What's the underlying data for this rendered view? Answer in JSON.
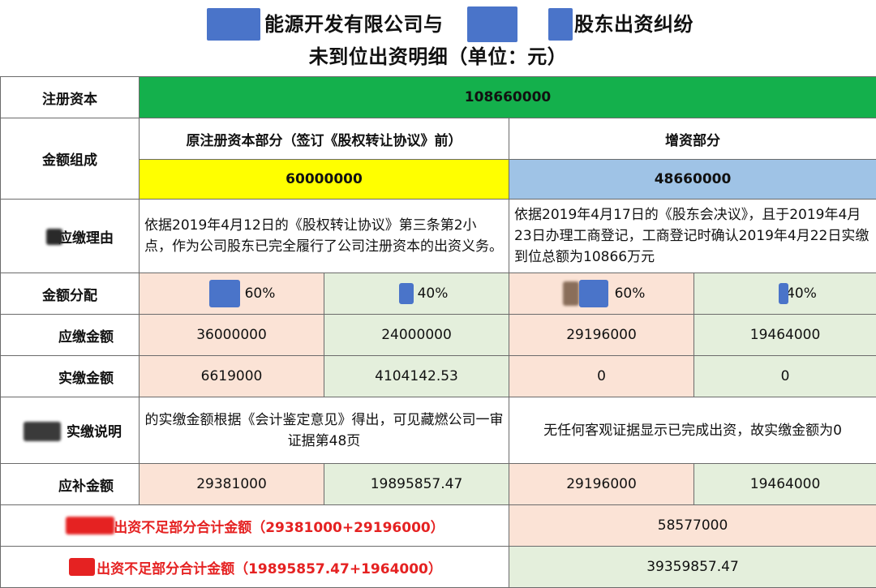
{
  "title": {
    "line1_part1": "能源开发有限公司与",
    "line1_part2": "股东出资纠纷",
    "line2": "未到位出资明细（单位：元）"
  },
  "rows": {
    "registered_capital": {
      "label": "注册资本",
      "value": "108660000"
    },
    "composition": {
      "label": "金额组成",
      "original_header": "原注册资本部分（签订《股权转让协议》前）",
      "increase_header": "增资部分",
      "original_value": "60000000",
      "increase_value": "48660000"
    },
    "payment_reason": {
      "label": "应缴理由",
      "original_text": "依据2019年4月12日的《股权转让协议》第三条第2小点，作为公司股东已完全履行了公司注册资本的出资义务。",
      "increase_text": "依据2019年4月17日的《股东会决议》，且于2019年4月23日办理工商登记，工商登记时确认2019年4月22日实缴到位总额为10866万元"
    },
    "allocation": {
      "label": "金额分配",
      "values": [
        "60%",
        "40%",
        "60%",
        "40%"
      ]
    },
    "payable": {
      "label": "应缴金额",
      "values": [
        "36000000",
        "24000000",
        "29196000",
        "19464000"
      ]
    },
    "paid": {
      "label": "实缴金额",
      "values": [
        "6619000",
        "4104142.53",
        "0",
        "0"
      ]
    },
    "paid_note": {
      "label": "实缴说明",
      "original_text": "的实缴金额根据《会计鉴定意见》得出，可见藏燃公司一审证据第48页",
      "increase_text": "无任何客观证据显示已完成出资，故实缴金额为0"
    },
    "supplement": {
      "label": "应补金额",
      "values": [
        "29381000",
        "19895857.47",
        "29196000",
        "19464000"
      ]
    },
    "total1": {
      "label": "出资不足部分合计金额（29381000+29196000）",
      "value": "58577000"
    },
    "total2": {
      "label": "出资不足部分合计金额（19895857.47+1964000）",
      "value": "39359857.47"
    }
  },
  "colors": {
    "registered_capital_bg": "#14b04c",
    "original_value_bg": "#ffff00",
    "increase_value_bg": "#9fc3e6",
    "peach_cell_bg": "#fbe3d6",
    "light_green_cell_bg": "#e4efdc",
    "total_label_text": "#e52222",
    "redaction_blue": "#4472c4"
  }
}
